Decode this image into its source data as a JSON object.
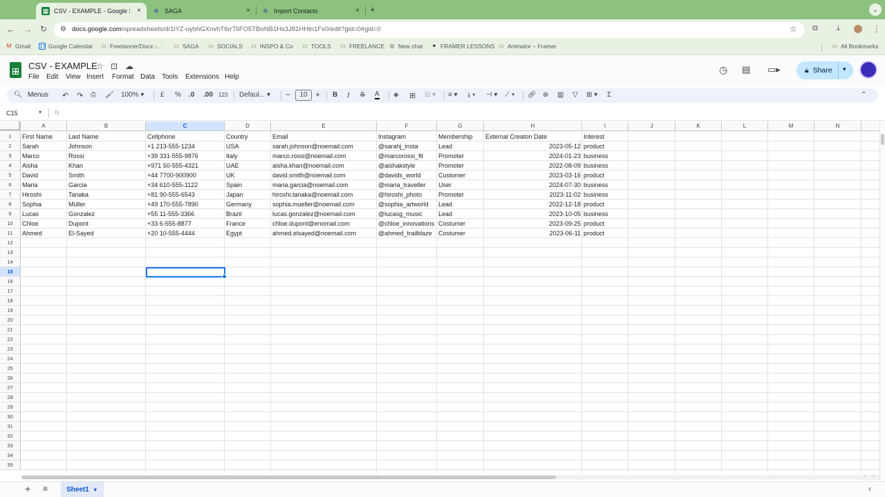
{
  "browser": {
    "tabs": [
      {
        "title": "CSV - EXAMPLE - Google Sh",
        "icon": "sheets-icon",
        "close": "×"
      },
      {
        "title": "SAGA",
        "icon": "saga-icon",
        "close": "×"
      },
      {
        "title": "Import Contacts",
        "icon": "saga-icon",
        "close": "×"
      }
    ],
    "new_tab": "+",
    "url_domain": "docs.google.com",
    "url_path": "/spreadsheets/d/1iYZ-uybhGXnvhT6rrTliFO5TBoNB1Hs3J81HHtn1Fx0/edit?gid=0#gid=0",
    "bookmarks": [
      "Gmail",
      "Google Calendar",
      "Freelancer/Docx -...",
      "SAGA",
      "SOCIALS",
      "INSPO & Co",
      "TOOLS",
      "FREELANCE",
      "New chat",
      "FRAMER LESSONS",
      "Animator – Framer"
    ],
    "all_bookmarks": "All Bookmarks"
  },
  "doc": {
    "title": "CSV - EXAMPLE",
    "menus": [
      "File",
      "Edit",
      "View",
      "Insert",
      "Format",
      "Data",
      "Tools",
      "Extensions",
      "Help"
    ],
    "share_label": "Share"
  },
  "toolbar": {
    "menus_label": "Menus",
    "zoom": "100%",
    "currency": "£",
    "percent": "%",
    "dec_less": ".0",
    "dec_more": ".00",
    "number_format": "123",
    "font": "Defaul...",
    "font_size": "10"
  },
  "formula": {
    "cell_ref": "C15",
    "fx": "fx"
  },
  "sheet": {
    "columns": [
      "A",
      "B",
      "C",
      "D",
      "E",
      "F",
      "G",
      "H",
      "I",
      "J",
      "K",
      "L",
      "M",
      "N"
    ],
    "selected_column": "C",
    "selected_row": "15",
    "row_numbers": [
      "1",
      "2",
      "3",
      "4",
      "5",
      "6",
      "7",
      "8",
      "9",
      "10",
      "11",
      "12",
      "13",
      "14",
      "15",
      "16",
      "17",
      "18",
      "19",
      "20",
      "21",
      "22",
      "23",
      "24",
      "25",
      "26",
      "27",
      "28",
      "29",
      "30",
      "31",
      "32",
      "33",
      "34",
      "35"
    ],
    "headers": [
      "First Name",
      "Last Name",
      "Cellphone",
      "Country",
      "Email",
      "Instagram",
      "Membership",
      "External Creaton Date",
      "Interest"
    ],
    "rows": [
      [
        "Sarah",
        "Johnson",
        "+1 213-555-1234",
        "USA",
        "sarah.johnson@noemail.com",
        "@sarahj_insta",
        "Lead",
        "2023-05-12",
        "product"
      ],
      [
        "Marco",
        "Rossi",
        "+39 331-555-9876",
        "Italy",
        "marco.rossi@noemail.com",
        "@marcorossi_fit",
        "Promoter",
        "2024-01-23",
        "business"
      ],
      [
        "Aisha",
        "Khan",
        "+971 50-555-4321",
        "UAE",
        "aisha.khan@noemail.com",
        "@aishakstyle",
        "Promoter",
        "2022-08-09",
        "business"
      ],
      [
        "David",
        "Smith",
        "+44 7700-900900",
        "UK",
        "david.smith@noemail.com",
        "@davids_world",
        "Customer",
        "2023-03-16",
        "product"
      ],
      [
        "Maria",
        "Garcia",
        "+34 610-555-1122",
        "Spain",
        "maria.garcia@noemail.com",
        "@maria_traveller",
        "User",
        "2024-07-30",
        "business"
      ],
      [
        "Hiroshi",
        "Tanaka",
        "+81 90-555-6543",
        "Japan",
        "hiroshi.tanaka@noemail.com",
        "@hiroshi_photo",
        "Promoter",
        "2023-11-02",
        "business"
      ],
      [
        "Sophia",
        "Müller",
        "+49 170-555-7890",
        "Germany",
        "sophia.mueller@noemail.com",
        "@sophia_artworld",
        "Lead",
        "2022-12-18",
        "product"
      ],
      [
        "Lucas",
        "Gonzalez",
        "+55 11-555-3366",
        "Brazil",
        "lucas.gonzalez@noemail.com",
        "@lucasg_music",
        "Lead",
        "2023-10-05",
        "business"
      ],
      [
        "Chloe",
        "Dupont",
        "+33 6-555-8877",
        "France",
        "chloe.dupont@enomail.com",
        "@chloe_innovations",
        "Costumer",
        "2023-09-25",
        "product"
      ],
      [
        "Ahmed",
        "El-Sayed",
        "+20 10-555-4444",
        "Egypt",
        "ahmed.elsayed@noemail.com",
        "@ahmed_trailblaze",
        "Costumer",
        "2023-06-11",
        "product"
      ]
    ],
    "tab_name": "Sheet1"
  },
  "colors": {
    "tabstrip": "#8cc27e",
    "toolbar": "#e7f2e2",
    "accent": "#1a73e8",
    "share": "#c2e7ff"
  }
}
